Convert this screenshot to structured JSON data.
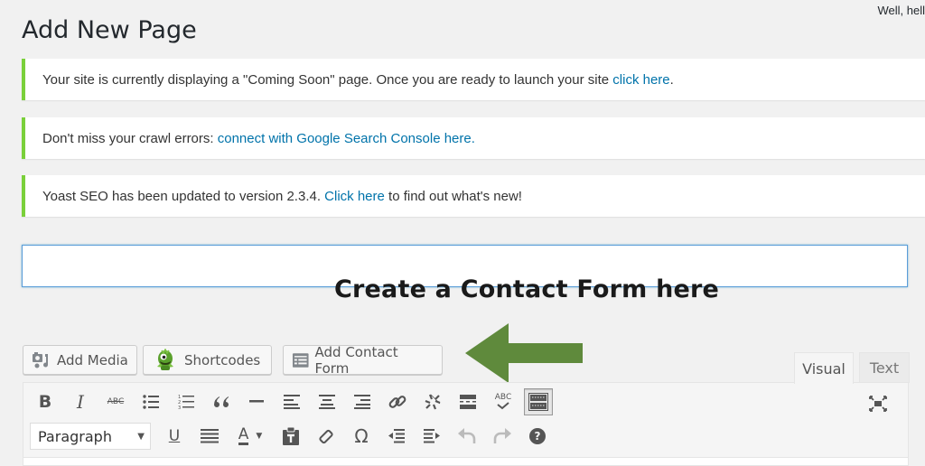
{
  "header": {
    "greeting": "Well, hell",
    "title": "Add New Page"
  },
  "notices": [
    {
      "text_before": "Your site is currently displaying a \"Coming Soon\" page. Once you are ready to launch your site ",
      "link": "click here",
      "text_after": "."
    },
    {
      "text_before": "Don't miss your crawl errors: ",
      "link": "connect with Google Search Console here.",
      "text_after": ""
    },
    {
      "text_before": "Yoast SEO has been updated to version 2.3.4. ",
      "link": "Click here",
      "text_after": " to find out what's new!"
    }
  ],
  "title_field": {
    "value": "",
    "placeholder": ""
  },
  "annotation": {
    "callout": "Create a Contact Form here",
    "arrow_color": "#5f8a3c"
  },
  "media_buttons": {
    "add_media": "Add Media",
    "shortcodes": "Shortcodes",
    "add_contact_form": "Add Contact Form"
  },
  "editor_tabs": {
    "visual": "Visual",
    "text": "Text",
    "active": "Visual"
  },
  "toolbar": {
    "row1": [
      "bold",
      "italic",
      "strikethrough",
      "bulleted-list",
      "numbered-list",
      "blockquote",
      "horizontal-line",
      "align-left",
      "align-center",
      "align-right",
      "insert-link",
      "remove-link",
      "read-more",
      "spellcheck",
      "toolbar-toggle"
    ],
    "row2": [
      "underline",
      "justify",
      "text-color",
      "paste-as-text",
      "clear-formatting",
      "special-character",
      "outdent",
      "indent",
      "undo",
      "redo",
      "keyboard-shortcuts"
    ],
    "format_select": "Paragraph",
    "strike_label": "ABC",
    "spell_label": "ABC",
    "omega": "Ω",
    "underline_label": "U",
    "color_label": "A",
    "italic_label": "I",
    "bold_label": "B",
    "help_label": "?"
  },
  "colors": {
    "notice_border": "#7ad03a",
    "link": "#0073aa",
    "focus_border": "#5b9dd9"
  }
}
